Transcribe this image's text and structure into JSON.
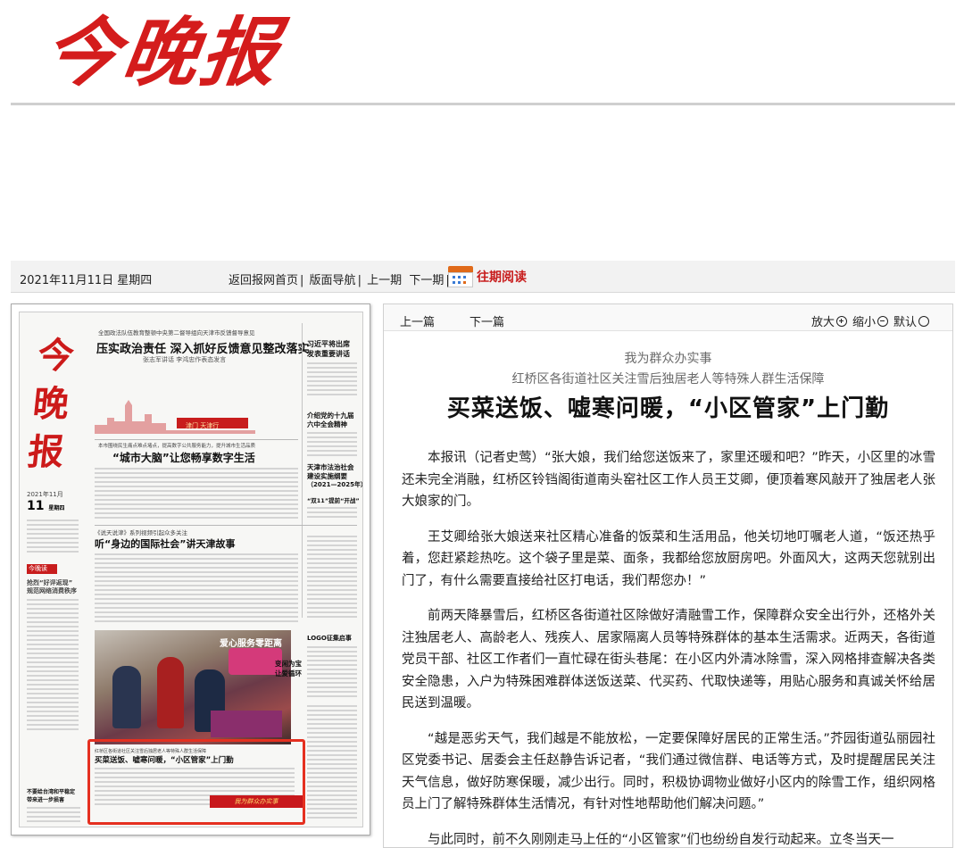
{
  "masthead": {
    "logo": "今晚报"
  },
  "toolbar": {
    "date": "2021年11月11日 星期四",
    "home": "返回报网首页",
    "layout_nav": "版面导航",
    "prev_issue": "上一期",
    "next_issue": "下一期",
    "archive": "往期阅读",
    "separator": "|"
  },
  "page_thumb": {
    "logo": "今晚报",
    "top_kicker": "全国政法队伍教育整顿中央第二督导组向天津市反馈督导意见",
    "lead_headline": "压实政治责任 深入抓好反馈意见整改落实",
    "lead_sub": "张志军讲话 李鸿忠作表态发言",
    "side_1": "习近平将出席",
    "side_1b": "发表重要讲话",
    "slogan": "津门 天津行",
    "smart_kicker": "本市围绕民生痛点难点堵点，提高数字公共服务能力，提升城市生活品质",
    "smart_headline": "“城市大脑”让您畅享数字生活",
    "side_2": "介绍党的十九届",
    "side_2b": "六中全会精神",
    "side_3": "天津市法治社会",
    "side_3b": "建设实施纲要",
    "side_3c": "（2021—2025年）",
    "side_4": "“双11”提前“开战”",
    "story_kicker": "《说天说津》系列视频引起众多关注",
    "story_headline": "听“身边的国际社会”讲天津故事",
    "side_date_year": "2021年11月",
    "side_date_day": "11",
    "side_date_week": "星期四",
    "side_tag": "今晚读",
    "side_note": "抢烈“好评返现”",
    "side_note_b": "规范网络消费秩序",
    "photo_banner": "爱心服务零距离",
    "logo_call": "LOGO征集启事",
    "side_5": "变闲为宝",
    "side_5b": "让爱循环",
    "hl_kicker": "红桥区各街道社区关注雪后独居老人等特殊人群生活保障",
    "hl_headline": "买菜送饭、嘘寒问暖，“小区管家”上门勤",
    "hl_banner": "我为群众办实事",
    "side_6": "不要给台湾和平稳定",
    "side_6b": "带来进一步损害"
  },
  "article_nav": {
    "prev": "上一篇",
    "next": "下一篇",
    "zoom_in": "放大",
    "zoom_out": "缩小",
    "default": "默认"
  },
  "article": {
    "kicker_1": "我为群众办实事",
    "kicker_2": "红桥区各街道社区关注雪后独居老人等特殊人群生活保障",
    "headline": "买菜送饭、嘘寒问暖，“小区管家”上门勤",
    "paragraphs": [
      "本报讯（记者史莺）“张大娘，我们给您送饭来了，家里还暖和吧？”昨天，小区里的冰雪还未完全消融，红桥区铃铛阁街道南头窑社区工作人员王艾卿，便顶着寒风敲开了独居老人张大娘家的门。",
      "王艾卿给张大娘送来社区精心准备的饭菜和生活用品，他关切地叮嘱老人道，“饭还热乎着，您赶紧趁热吃。这个袋子里是菜、面条，我都给您放厨房吧。外面风大，这两天您就别出门了，有什么需要直接给社区打电话，我们帮您办！”",
      "前两天降暴雪后，红桥区各街道社区除做好清融雪工作，保障群众安全出行外，还格外关注独居老人、高龄老人、残疾人、居家隔离人员等特殊群体的基本生活需求。近两天，各街道党员干部、社区工作者们一直忙碌在街头巷尾：在小区内外清冰除雪，深入网格排查解决各类安全隐患，入户为特殊困难群体送饭送菜、代买药、代取快递等，用贴心服务和真诚关怀给居民送到温暖。",
      "“越是恶劣天气，我们越是不能放松，一定要保障好居民的正常生活。”芥园街道弘丽园社区党委书记、居委会主任赵静告诉记者，“我们通过微信群、电话等方式，及时提醒居民关注天气信息，做好防寒保暖，减少出行。同时，积极协调物业做好小区内的除雪工作，组织网格员上门了解特殊群体生活情况，有针对性地帮助他们解决问题。”",
      "与此同时，前不久刚刚走马上任的“小区管家”们也纷纷自发行动起来。立冬当天一"
    ]
  },
  "colors": {
    "brand_red": "#d41c1c",
    "highlight_red": "#e53020"
  },
  "icons": [
    "calendar-icon",
    "zoom-in-icon",
    "zoom-out-icon",
    "default-radio-icon"
  ]
}
